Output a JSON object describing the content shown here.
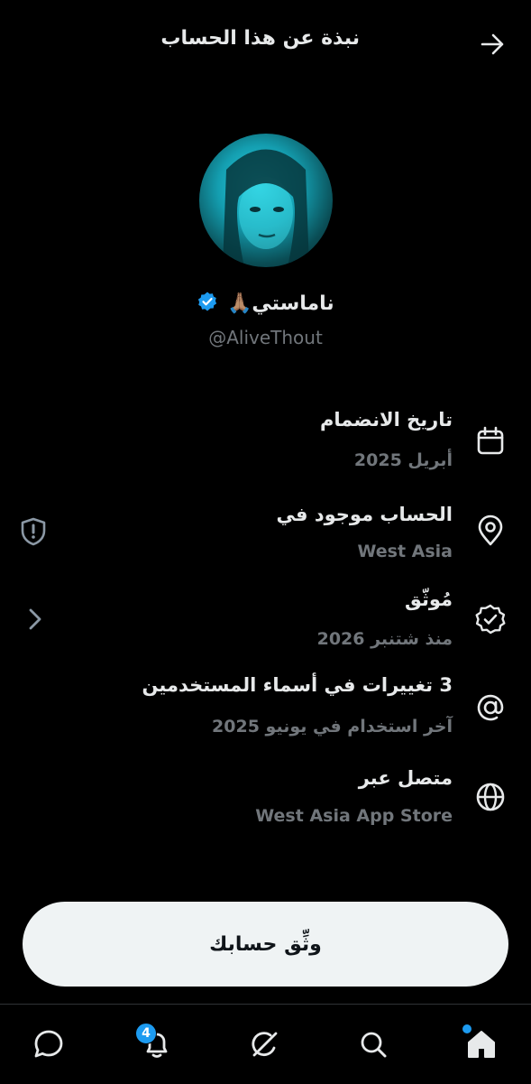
{
  "header": {
    "title": "نبذة عن هذا الحساب"
  },
  "profile": {
    "display_name": "ناماستي",
    "emoji": "🙏🏽",
    "handle": "@AliveThout"
  },
  "info": [
    {
      "title": "تاريخ الانضمام",
      "subtitle": "أبريل 2025",
      "icon": "calendar-icon"
    },
    {
      "title": "الحساب موجود في",
      "subtitle": "West Asia",
      "icon": "location-pin-icon"
    },
    {
      "title": "مُوثّق",
      "subtitle": "منذ شتنبر 2026",
      "icon": "verified-badge-icon"
    },
    {
      "title": "3 تغييرات في أسماء المستخدمين",
      "subtitle": "آخر استخدام في يونيو 2025",
      "icon": "at-sign-icon"
    },
    {
      "title": "متصل عبر",
      "subtitle": "West Asia App Store",
      "icon": "globe-icon"
    }
  ],
  "cta": {
    "label": "وثِّق حسابك"
  },
  "bottom_nav": {
    "notifications_badge": "4",
    "items": [
      "messages-icon",
      "notifications-icon",
      "grok-icon",
      "search-icon",
      "home-icon"
    ]
  },
  "colors": {
    "accent": "#1d9bf0",
    "muted": "#71767b",
    "background": "#000000"
  }
}
